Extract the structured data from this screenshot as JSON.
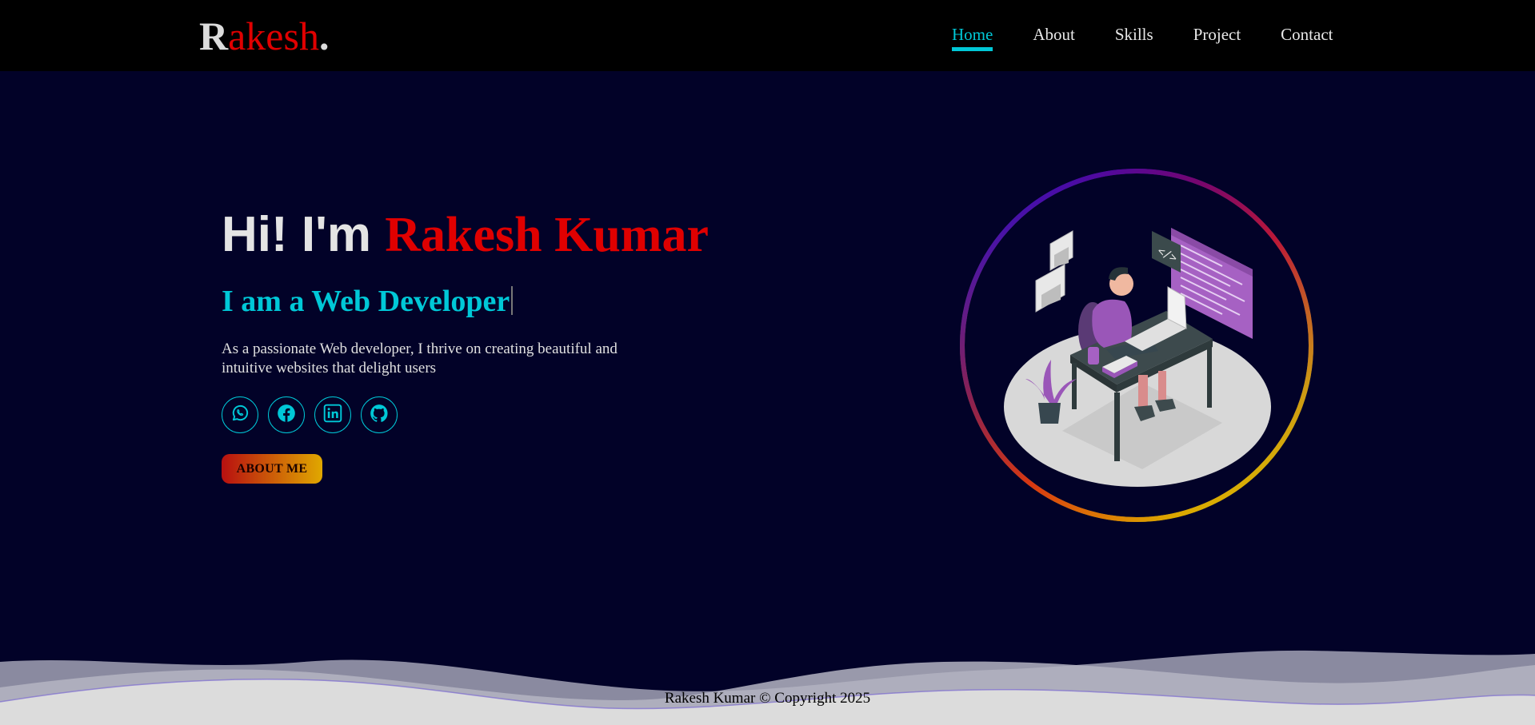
{
  "header": {
    "logo_first": "R",
    "logo_rest": "akesh",
    "logo_dot": ".",
    "nav": [
      {
        "label": "Home",
        "active": true
      },
      {
        "label": "About",
        "active": false
      },
      {
        "label": "Skills",
        "active": false
      },
      {
        "label": "Project",
        "active": false
      },
      {
        "label": "Contact",
        "active": false
      }
    ]
  },
  "hero": {
    "greeting": "Hi! I'm ",
    "name": "Rakesh Kumar",
    "role": "I am a Web Developer",
    "description": "As a passionate Web developer, I thrive on creating beautiful and intuitive websites that delight users",
    "socials": [
      {
        "icon": "whatsapp-icon"
      },
      {
        "icon": "facebook-icon"
      },
      {
        "icon": "linkedin-icon"
      },
      {
        "icon": "github-icon"
      }
    ],
    "button_label": "ABOUT ME"
  },
  "footer": {
    "copyright": "Rakesh Kumar © Copyright 2025"
  },
  "colors": {
    "accent": "#00c8d7",
    "brand_red": "#e00000",
    "background": "#020228",
    "navbar": "#000000"
  }
}
